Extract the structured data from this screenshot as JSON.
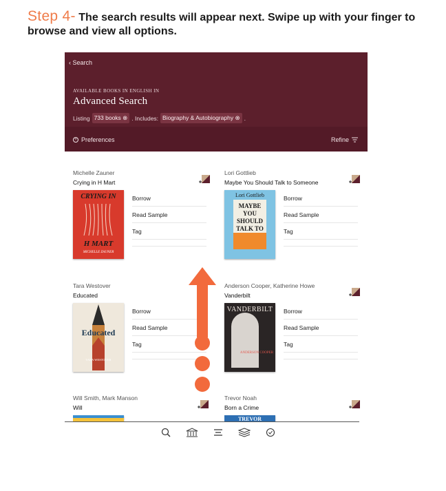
{
  "step": {
    "label": "Step 4-",
    "text": "The search results will appear next. Swipe up with your finger to browse and view all options."
  },
  "header": {
    "back_label": "Search",
    "subtitle": "AVAILABLE BOOKS IN ENGLISH IN",
    "title": "Advanced Search",
    "listing_prefix": "Listing",
    "listing_count": "733 books",
    "includes_label": ". Includes:",
    "includes_value": "Biography & Autobiography",
    "preferences_label": "Preferences",
    "refine_label": "Refine"
  },
  "books": [
    {
      "author": "Michelle Zauner",
      "title": "Crying in H Mart",
      "cover_title": "CRYING IN",
      "cover_title2": "H MART",
      "cover_author": "MICHELLE ZAUNER"
    },
    {
      "author": "Lori Gottlieb",
      "title": "Maybe You Should Talk to Someone",
      "cover_author": "Lori Gottlieb",
      "cover_title": "MAYBE YOU SHOULD TALK TO SOMEONE"
    },
    {
      "author": "Tara Westover",
      "title": "Educated",
      "cover_title": "Educated",
      "cover_author": "TARA WESTOVER"
    },
    {
      "author": "Anderson Cooper, Katherine Howe",
      "title": "Vanderbilt",
      "cover_title": "VANDERBILT",
      "cover_author": "ANDERSON COOPER"
    },
    {
      "author": "Will Smith, Mark Manson",
      "title": "Will"
    },
    {
      "author": "Trevor Noah",
      "title": "Born a Crime",
      "cover_title": "TREVOR"
    }
  ],
  "actions": {
    "borrow": "Borrow",
    "read_sample": "Read Sample",
    "tag": "Tag"
  },
  "colors": {
    "accent": "#ef7c4a",
    "header": "#5c1f2c",
    "arrow": "#f26a3c"
  },
  "tabbar_icons": [
    "search-icon",
    "library-icon",
    "menu-icon",
    "shelf-icon",
    "activity-icon"
  ]
}
